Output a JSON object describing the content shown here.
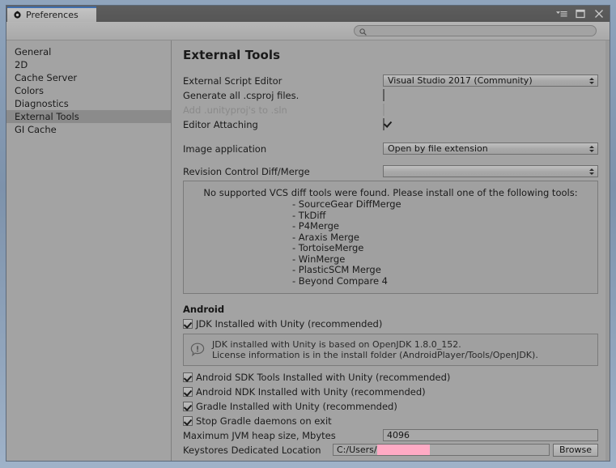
{
  "window": {
    "tab_label": "Preferences",
    "tab_icon": "gear-icon",
    "controls": [
      {
        "name": "panel-menu-icon",
        "glyph": "menu"
      },
      {
        "name": "maximize-icon",
        "glyph": "square"
      },
      {
        "name": "close-icon",
        "glyph": "x"
      }
    ]
  },
  "toolbar": {
    "search_value": "",
    "search_placeholder": "",
    "search_icon": "search-icon"
  },
  "sidebar": {
    "items": [
      {
        "label": "General",
        "selected": false
      },
      {
        "label": "2D",
        "selected": false
      },
      {
        "label": "Cache Server",
        "selected": false
      },
      {
        "label": "Colors",
        "selected": false
      },
      {
        "label": "Diagnostics",
        "selected": false
      },
      {
        "label": "External Tools",
        "selected": true
      },
      {
        "label": "GI Cache",
        "selected": false
      }
    ]
  },
  "main": {
    "title": "External Tools",
    "external_script_editor": {
      "label": "External Script Editor",
      "value": "Visual Studio 2017 (Community)"
    },
    "generate_csproj": {
      "label": "Generate all .csproj files.",
      "checked": false,
      "disabled": false
    },
    "add_unityproj": {
      "label": "Add .unityproj's to .sln",
      "checked": false,
      "disabled": true
    },
    "editor_attaching": {
      "label": "Editor Attaching",
      "checked": true,
      "disabled": false
    },
    "image_application": {
      "label": "Image application",
      "value": "Open by file extension"
    },
    "revision_control": {
      "label": "Revision Control Diff/Merge",
      "value": ""
    },
    "vcs_help": {
      "heading": "No supported VCS diff tools were found. Please install one of the following tools:",
      "tools": [
        "- SourceGear DiffMerge",
        "- TkDiff",
        "- P4Merge",
        "- Araxis Merge",
        "- TortoiseMerge",
        "- WinMerge",
        "- PlasticSCM Merge",
        "- Beyond Compare 4"
      ]
    },
    "android": {
      "heading": "Android",
      "jdk_checkbox": {
        "label": "JDK Installed with Unity (recommended)",
        "checked": true
      },
      "jdk_info": {
        "icon": "info-exclamation-icon",
        "line1": "JDK installed with Unity is based on OpenJDK 1.8.0_152.",
        "line2": "License information is in the install folder (AndroidPlayer/Tools/OpenJDK)."
      },
      "checkboxes": [
        {
          "label": "Android SDK Tools Installed with Unity (recommended)",
          "checked": true
        },
        {
          "label": "Android NDK Installed with Unity (recommended)",
          "checked": true
        },
        {
          "label": "Gradle Installed with Unity (recommended)",
          "checked": true
        },
        {
          "label": "Stop Gradle daemons on exit",
          "checked": true
        }
      ],
      "jvm_heap": {
        "label": "Maximum JVM heap size, Mbytes",
        "value": "4096"
      },
      "keystores": {
        "label": "Keystores Dedicated Location",
        "value": "C:/Users/",
        "redacted": true,
        "browse_label": "Browse"
      }
    }
  },
  "colors": {
    "panel_bg": "#a3a3a3",
    "titlebar_bg": "#565656",
    "selection_bg": "#8b8b8b",
    "tab_accent": "#3e6fb0",
    "redaction": "#ffaac4",
    "window_chrome": "#8fa4bc"
  }
}
